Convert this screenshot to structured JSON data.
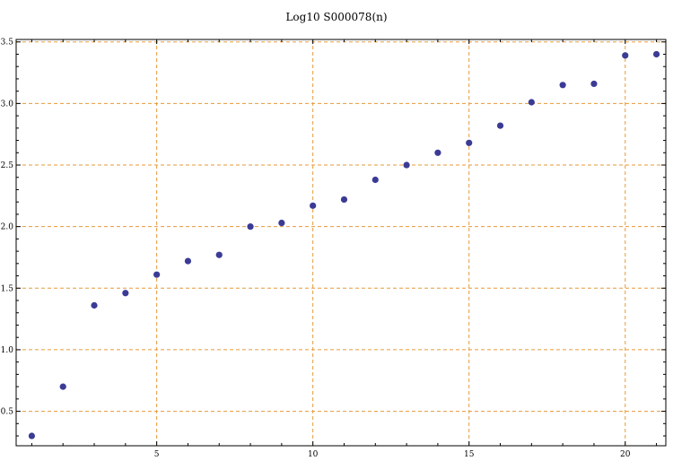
{
  "chart_data": {
    "type": "scatter",
    "title": "Log10 S000078(n)",
    "xlabel": "",
    "ylabel": "",
    "x": [
      1,
      2,
      3,
      4,
      5,
      6,
      7,
      8,
      9,
      10,
      11,
      12,
      13,
      14,
      15,
      16,
      17,
      18,
      19,
      20,
      21
    ],
    "y": [
      0.3,
      0.7,
      1.36,
      1.46,
      1.61,
      1.72,
      1.77,
      2.0,
      2.03,
      2.17,
      2.22,
      2.38,
      2.5,
      2.6,
      2.68,
      2.82,
      3.01,
      3.15,
      3.16,
      3.39,
      3.4
    ],
    "xlim": [
      0.5,
      21.3
    ],
    "ylim": [
      0.22,
      3.52
    ],
    "xticks": [
      5,
      10,
      15,
      20
    ],
    "yticks": [
      0.5,
      1.0,
      1.5,
      2.0,
      2.5,
      3.0,
      3.5
    ],
    "xtick_labels": [
      "5",
      "10",
      "15",
      "20"
    ],
    "ytick_labels": [
      "0.5",
      "1.0",
      "1.5",
      "2.0",
      "2.5",
      "3.0",
      "3.5"
    ],
    "grid": true,
    "colors": {
      "point": "#3b3b96",
      "grid": "#e69a3a",
      "axis": "#000000"
    }
  }
}
